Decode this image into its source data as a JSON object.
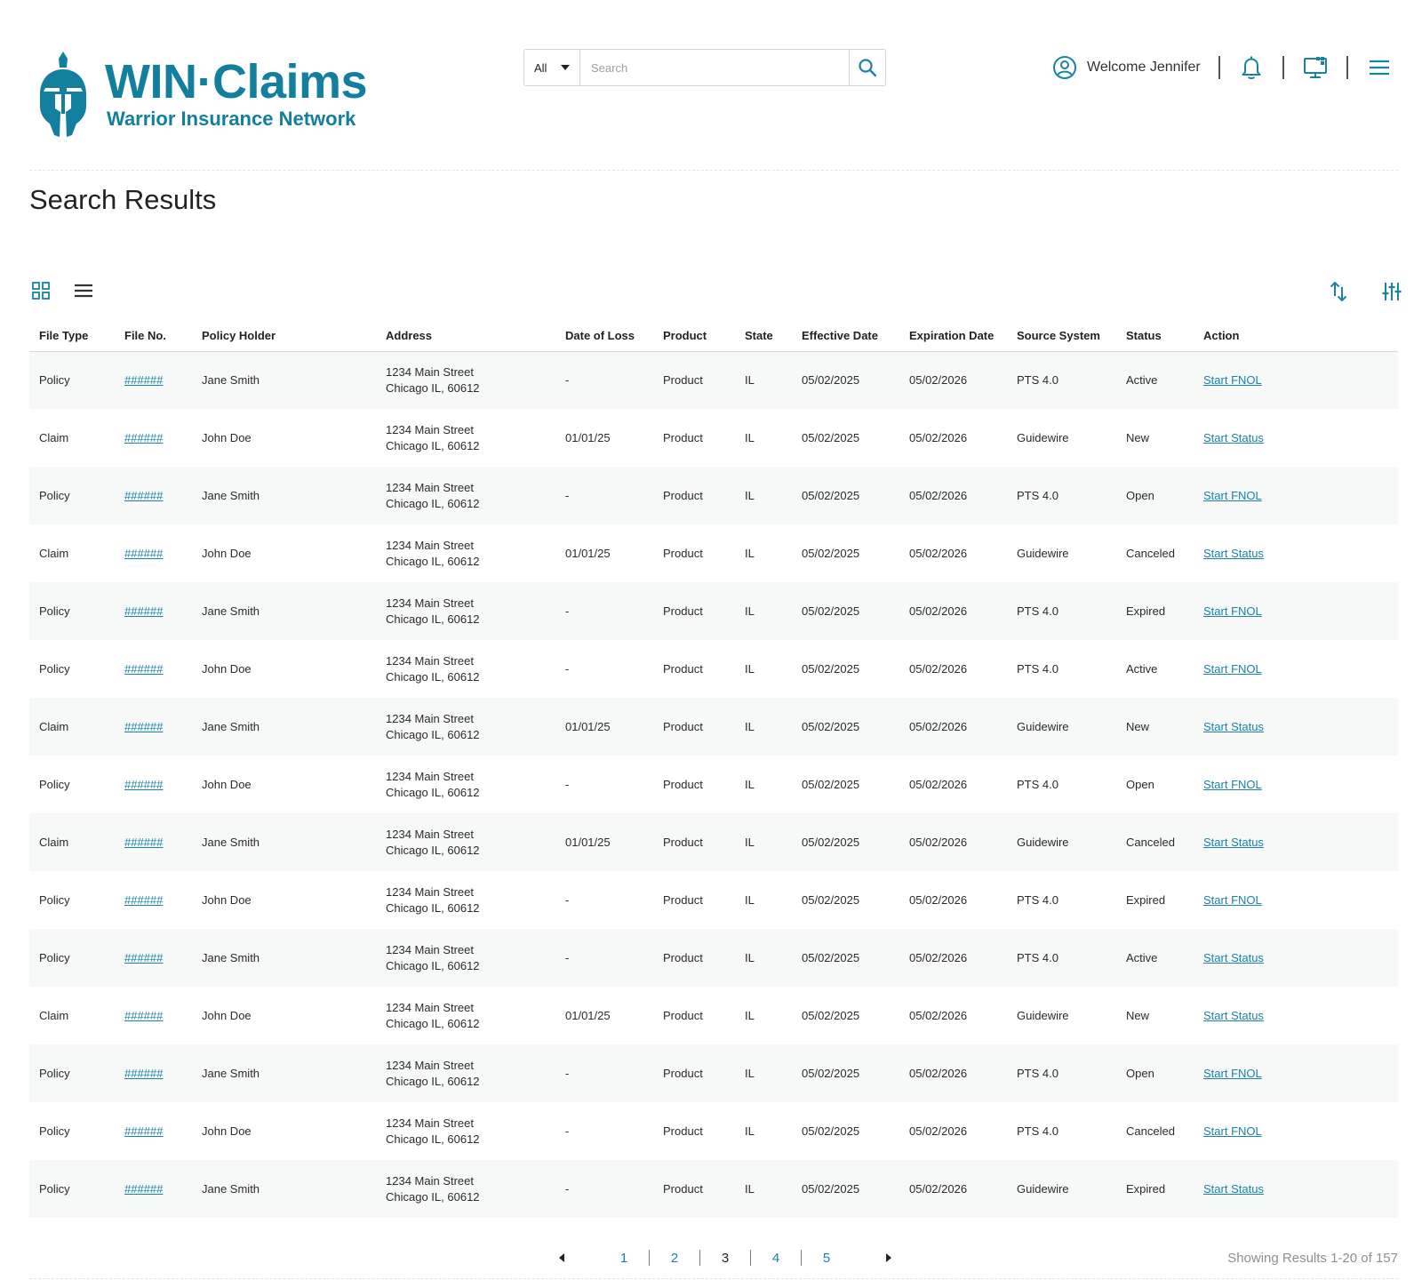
{
  "brand": {
    "title": "WIN·Claims",
    "subtitle": "Warrior Insurance Network",
    "color": "#127f9e"
  },
  "search": {
    "scope": "All",
    "placeholder": "Search",
    "value": ""
  },
  "header": {
    "welcome": "Welcome Jennifer",
    "icons": [
      "user-circle-icon",
      "bell-icon",
      "monitor-icon",
      "menu-icon"
    ]
  },
  "page": {
    "title": "Search Results"
  },
  "toolbar": {
    "views": [
      "grid-view-icon",
      "list-view-icon"
    ],
    "tools": [
      "sort-icon",
      "filter-sliders-icon"
    ]
  },
  "table": {
    "columns": [
      "File Type",
      "File No.",
      "Policy Holder",
      "Address",
      "Date of Loss",
      "Product",
      "State",
      "Effective Date",
      "Expiration Date",
      "Source System",
      "Status",
      "Action"
    ],
    "rows": [
      {
        "type": "Policy",
        "file_no": "######",
        "holder": "Jane Smith",
        "addr1": "1234 Main Street",
        "addr2": "Chicago IL, 60612",
        "loss": "-",
        "product": "Product",
        "state": "IL",
        "eff": "05/02/2025",
        "exp": "05/02/2026",
        "source": "PTS 4.0",
        "status": "Active",
        "action": "Start FNOL"
      },
      {
        "type": "Claim",
        "file_no": "######",
        "holder": "John Doe",
        "addr1": "1234 Main Street",
        "addr2": "Chicago IL, 60612",
        "loss": "01/01/25",
        "product": "Product",
        "state": "IL",
        "eff": "05/02/2025",
        "exp": "05/02/2026",
        "source": "Guidewire",
        "status": "New",
        "action": "Start Status"
      },
      {
        "type": "Policy",
        "file_no": "######",
        "holder": "Jane Smith",
        "addr1": "1234 Main Street",
        "addr2": "Chicago IL, 60612",
        "loss": "-",
        "product": "Product",
        "state": "IL",
        "eff": "05/02/2025",
        "exp": "05/02/2026",
        "source": "PTS 4.0",
        "status": "Open",
        "action": "Start FNOL"
      },
      {
        "type": "Claim",
        "file_no": "######",
        "holder": "John Doe",
        "addr1": "1234 Main Street",
        "addr2": "Chicago IL, 60612",
        "loss": "01/01/25",
        "product": "Product",
        "state": "IL",
        "eff": "05/02/2025",
        "exp": "05/02/2026",
        "source": "Guidewire",
        "status": "Canceled",
        "action": "Start Status"
      },
      {
        "type": "Policy",
        "file_no": "######",
        "holder": "Jane Smith",
        "addr1": "1234 Main Street",
        "addr2": "Chicago IL, 60612",
        "loss": "-",
        "product": "Product",
        "state": "IL",
        "eff": "05/02/2025",
        "exp": "05/02/2026",
        "source": "PTS 4.0",
        "status": "Expired",
        "action": "Start FNOL"
      },
      {
        "type": "Policy",
        "file_no": "######",
        "holder": "John Doe",
        "addr1": "1234 Main Street",
        "addr2": "Chicago IL, 60612",
        "loss": "-",
        "product": "Product",
        "state": "IL",
        "eff": "05/02/2025",
        "exp": "05/02/2026",
        "source": "PTS 4.0",
        "status": "Active",
        "action": "Start FNOL"
      },
      {
        "type": "Claim",
        "file_no": "######",
        "holder": "Jane Smith",
        "addr1": "1234 Main Street",
        "addr2": "Chicago IL, 60612",
        "loss": "01/01/25",
        "product": "Product",
        "state": "IL",
        "eff": "05/02/2025",
        "exp": "05/02/2026",
        "source": "Guidewire",
        "status": "New",
        "action": "Start Status"
      },
      {
        "type": "Policy",
        "file_no": "######",
        "holder": "John Doe",
        "addr1": "1234 Main Street",
        "addr2": "Chicago IL, 60612",
        "loss": "-",
        "product": "Product",
        "state": "IL",
        "eff": "05/02/2025",
        "exp": "05/02/2026",
        "source": "PTS 4.0",
        "status": "Open",
        "action": "Start FNOL"
      },
      {
        "type": "Claim",
        "file_no": "######",
        "holder": "Jane Smith",
        "addr1": "1234 Main Street",
        "addr2": "Chicago IL, 60612",
        "loss": "01/01/25",
        "product": "Product",
        "state": "IL",
        "eff": "05/02/2025",
        "exp": "05/02/2026",
        "source": "Guidewire",
        "status": "Canceled",
        "action": "Start Status"
      },
      {
        "type": "Policy",
        "file_no": "######",
        "holder": "John Doe",
        "addr1": "1234 Main Street",
        "addr2": "Chicago IL, 60612",
        "loss": "-",
        "product": "Product",
        "state": "IL",
        "eff": "05/02/2025",
        "exp": "05/02/2026",
        "source": "PTS 4.0",
        "status": "Expired",
        "action": "Start FNOL"
      },
      {
        "type": "Policy",
        "file_no": "######",
        "holder": "Jane Smith",
        "addr1": "1234 Main Street",
        "addr2": "Chicago IL, 60612",
        "loss": "-",
        "product": "Product",
        "state": "IL",
        "eff": "05/02/2025",
        "exp": "05/02/2026",
        "source": "PTS 4.0",
        "status": "Active",
        "action": "Start Status"
      },
      {
        "type": "Claim",
        "file_no": "######",
        "holder": "John Doe",
        "addr1": "1234 Main Street",
        "addr2": "Chicago IL, 60612",
        "loss": "01/01/25",
        "product": "Product",
        "state": "IL",
        "eff": "05/02/2025",
        "exp": "05/02/2026",
        "source": "Guidewire",
        "status": "New",
        "action": "Start Status"
      },
      {
        "type": "Policy",
        "file_no": "######",
        "holder": "Jane Smith",
        "addr1": "1234 Main Street",
        "addr2": "Chicago IL, 60612",
        "loss": "-",
        "product": "Product",
        "state": "IL",
        "eff": "05/02/2025",
        "exp": "05/02/2026",
        "source": "PTS 4.0",
        "status": "Open",
        "action": "Start FNOL"
      },
      {
        "type": "Policy",
        "file_no": "######",
        "holder": "John Doe",
        "addr1": "1234 Main Street",
        "addr2": "Chicago IL, 60612",
        "loss": "-",
        "product": "Product",
        "state": "IL",
        "eff": "05/02/2025",
        "exp": "05/02/2026",
        "source": "PTS 4.0",
        "status": "Canceled",
        "action": "Start FNOL"
      },
      {
        "type": "Policy",
        "file_no": "######",
        "holder": "Jane Smith",
        "addr1": "1234 Main Street",
        "addr2": "Chicago IL, 60612",
        "loss": "-",
        "product": "Product",
        "state": "IL",
        "eff": "05/02/2025",
        "exp": "05/02/2026",
        "source": "Guidewire",
        "status": "Expired",
        "action": "Start Status"
      }
    ]
  },
  "pagination": {
    "pages": [
      "1",
      "2",
      "3",
      "4",
      "5"
    ],
    "current": "3",
    "showing": "Showing Results 1-20 of 157"
  },
  "colors": {
    "accent": "#1a83a4",
    "row_alt": "#f7f8f8"
  }
}
